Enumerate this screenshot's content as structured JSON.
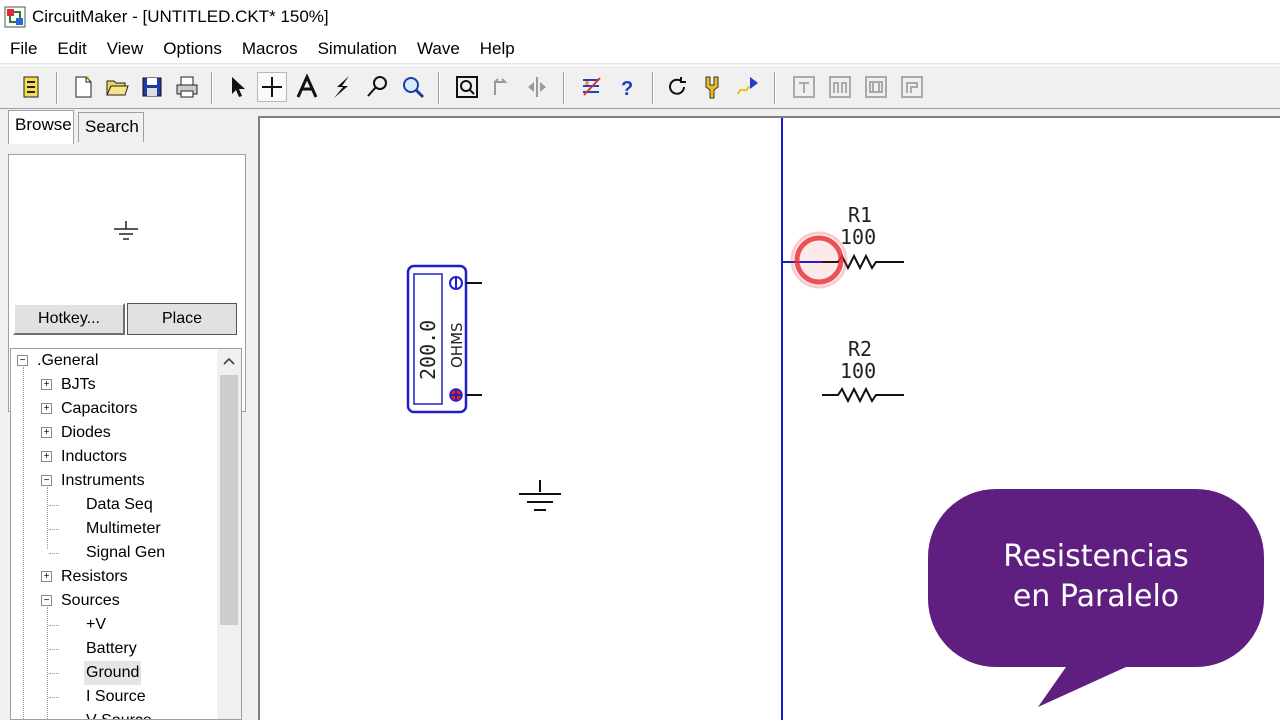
{
  "window": {
    "title": "CircuitMaker - [UNTITLED.CKT* 150%]"
  },
  "menu": [
    "File",
    "Edit",
    "View",
    "Options",
    "Macros",
    "Simulation",
    "Wave",
    "Help"
  ],
  "panel": {
    "tabs": [
      "Browse",
      "Search"
    ],
    "hotkey_label": "Hotkey...",
    "place_label": "Place"
  },
  "tree": {
    "root": ".General",
    "items": [
      "BJTs",
      "Capacitors",
      "Diodes",
      "Inductors",
      "Instruments",
      "Data Seq",
      "Multimeter",
      "Signal Gen",
      "Resistors",
      "Sources",
      "+V",
      "Battery",
      "Ground",
      "I Source",
      "V Source"
    ],
    "selected": "Ground"
  },
  "schematic": {
    "meter_value": "200.0",
    "meter_unit": "OHMS",
    "r1_name": "R1",
    "r1_value": "100",
    "r2_name": "R2",
    "r2_value": "100"
  },
  "overlay": {
    "line1": "Resistencias",
    "line2": "en Paralelo",
    "color": "#5e1f80"
  },
  "colors": {
    "wire": "#1818d0",
    "meter_border": "#2020c8",
    "cursor_ring": "#e8343c"
  }
}
